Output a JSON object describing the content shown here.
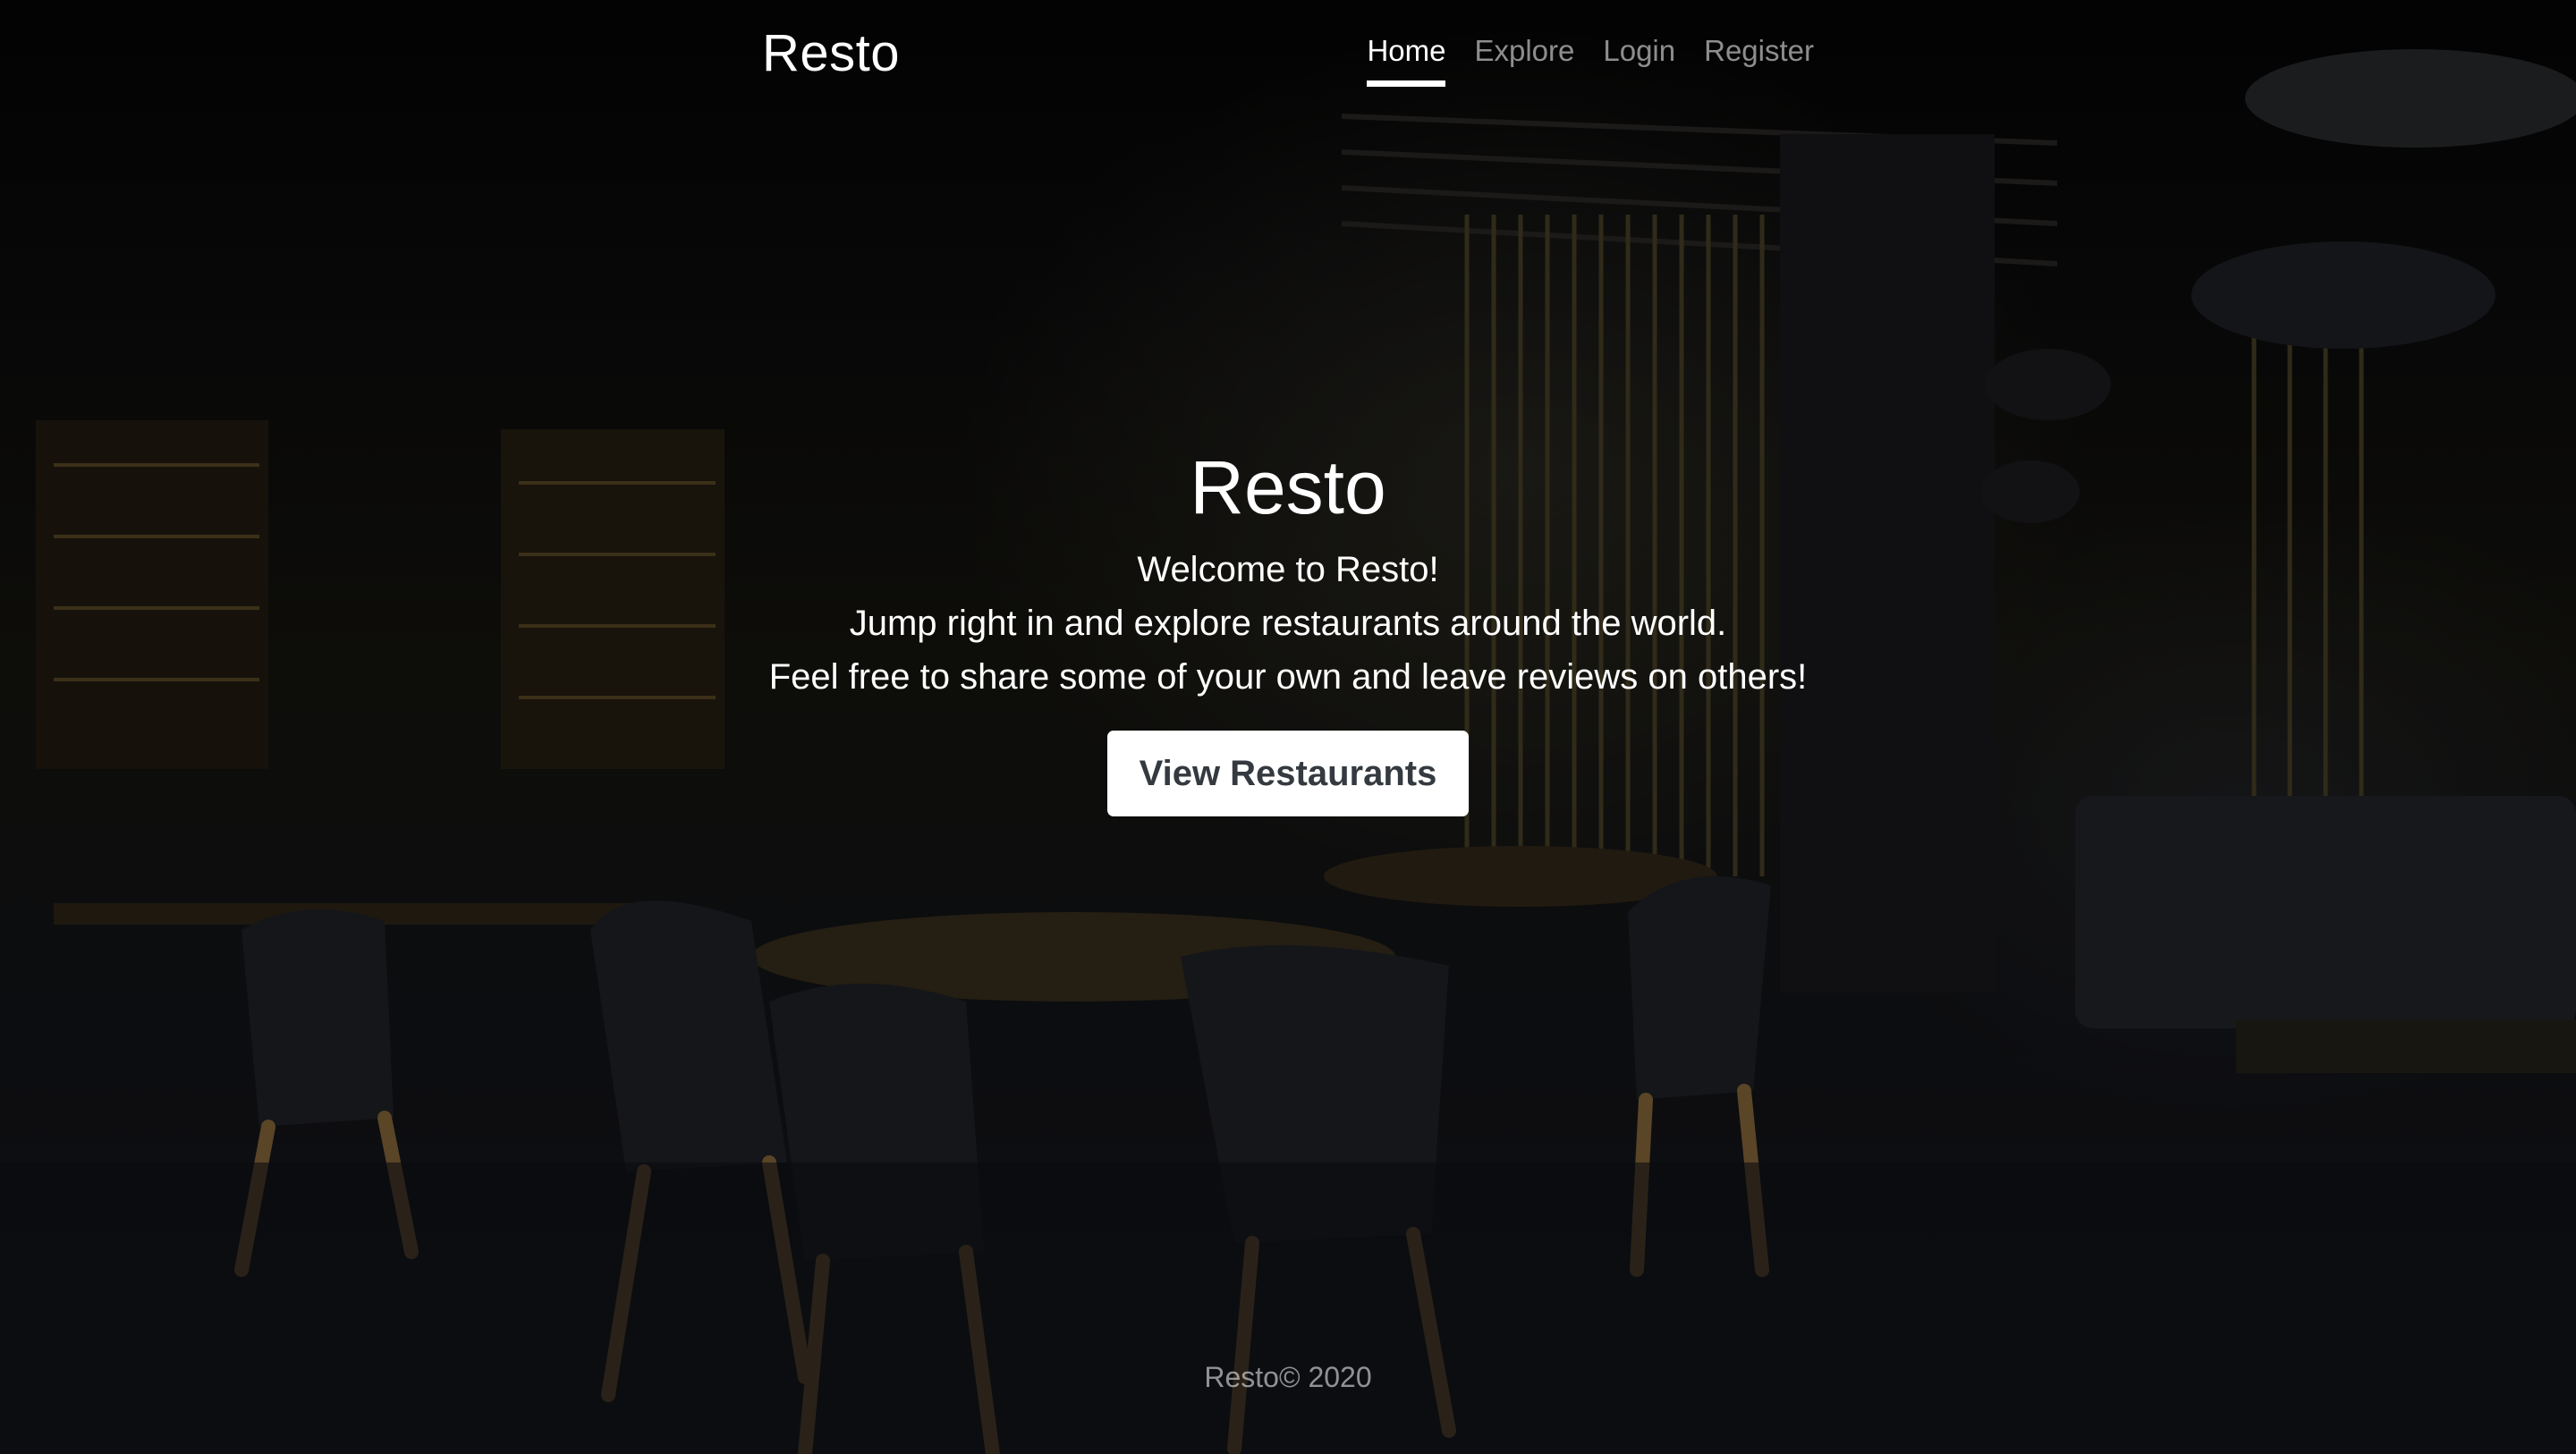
{
  "nav": {
    "brand": "Resto",
    "links": [
      {
        "label": "Home",
        "active": true
      },
      {
        "label": "Explore",
        "active": false
      },
      {
        "label": "Login",
        "active": false
      },
      {
        "label": "Register",
        "active": false
      }
    ]
  },
  "main": {
    "heading": "Resto",
    "lines": [
      "Welcome to Resto!",
      "Jump right in and explore restaurants around the world.",
      "Feel free to share some of your own and leave reviews on others!"
    ],
    "cta_label": "View Restaurants"
  },
  "footer": {
    "text": "Resto© 2020"
  },
  "colors": {
    "button_bg": "#ffffff",
    "button_text": "#343a40",
    "muted_text": "#8c8c8c"
  }
}
